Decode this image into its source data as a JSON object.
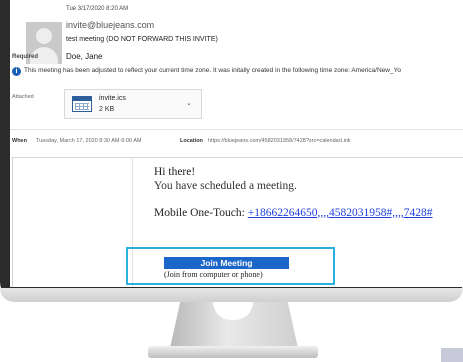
{
  "email": {
    "date": "Tue 3/17/2020 8:20 AM",
    "from": "invite@bluejeans.com",
    "subject": "test meeting  (DO NOT FORWARD THIS INVITE)",
    "required_label": "Required",
    "attendee": "Doe, Jane",
    "info_text": "This meeting has been adjusted to reflect your current time zone. It was initally created in the following time zone: America/New_Yo",
    "attached_label": "Attached",
    "attachment": {
      "name": "invite.ics",
      "size": "2 KB",
      "icon": "calendar-file-icon"
    },
    "when_label": "When",
    "when_value": "Tuesday, March 17, 2020 8:30 AM-9:00 AM",
    "location_label": "Location",
    "location_value": "https://bluejeans.com/4582031958/7428?src=calendarLink"
  },
  "body": {
    "greeting": "Hi there!",
    "scheduled": "You have scheduled a meeting.",
    "onetouch_label": "Mobile One-Touch: ",
    "onetouch_number": "+18662264650,,,,4582031958#,,,,7428#",
    "join_button": "Join Meeting",
    "join_sub": "(Join from computer or phone)"
  },
  "colors": {
    "accent_highlight": "#2ab0df",
    "join_button": "#1b66c9",
    "link": "#1f3fdc"
  }
}
